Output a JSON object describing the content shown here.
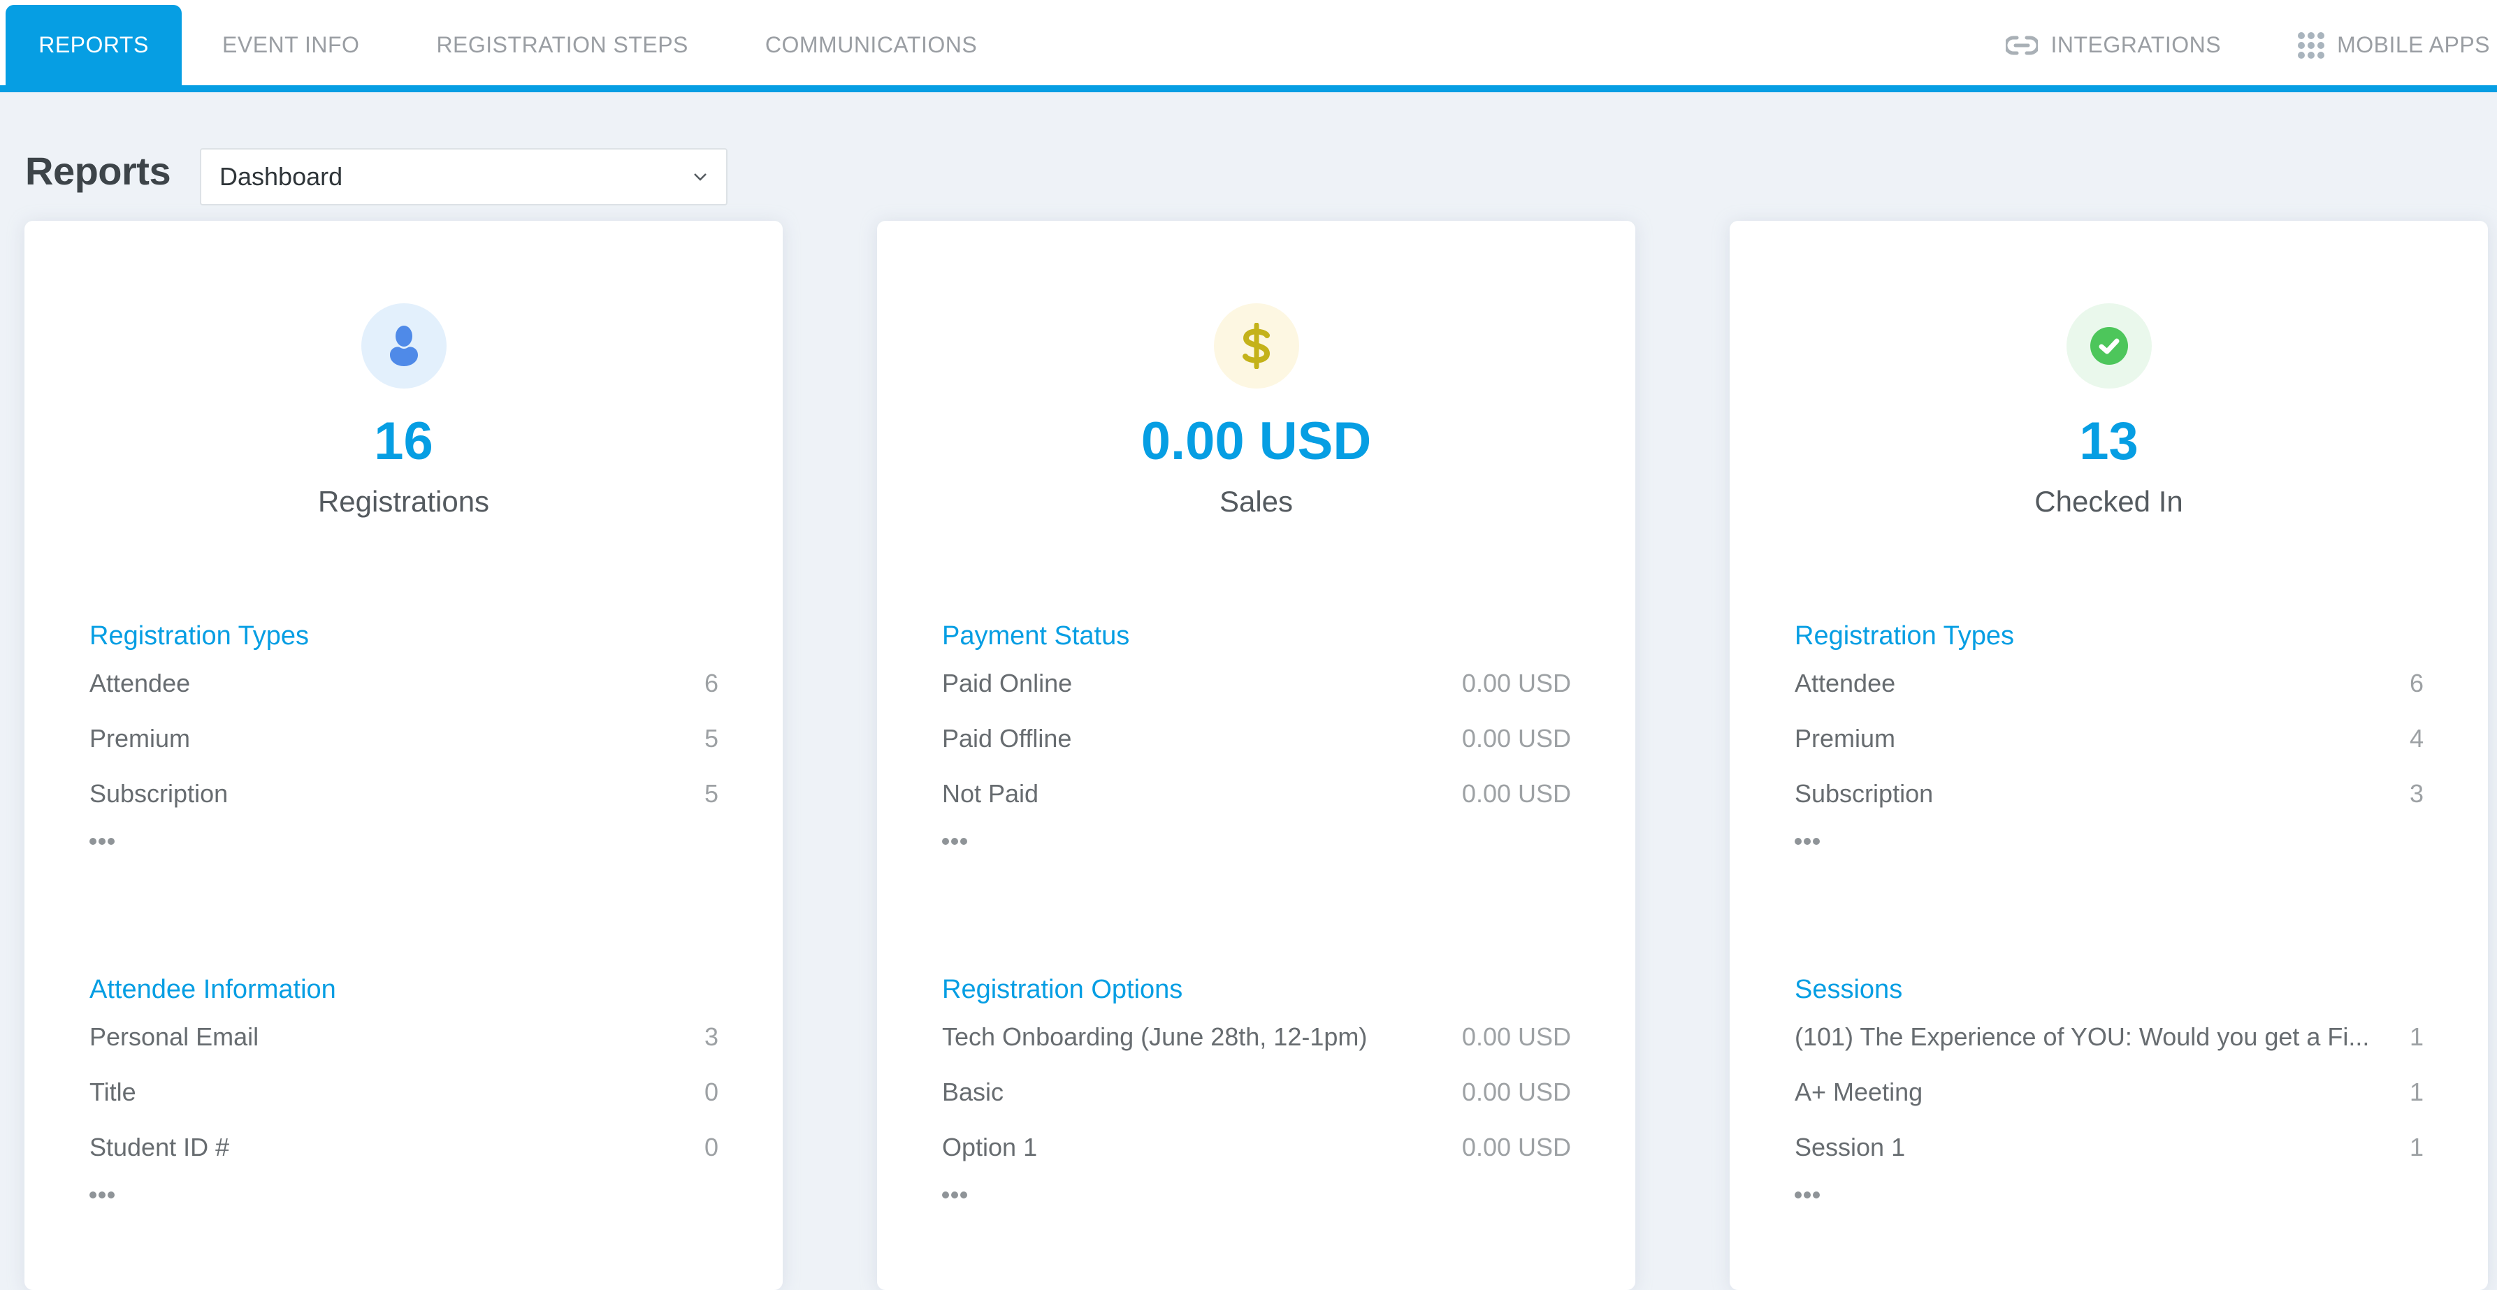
{
  "nav": {
    "tabs": [
      {
        "label": "REPORTS",
        "active": true
      },
      {
        "label": "EVENT INFO",
        "active": false
      },
      {
        "label": "REGISTRATION STEPS",
        "active": false
      },
      {
        "label": "COMMUNICATIONS",
        "active": false
      }
    ],
    "right_links": [
      {
        "label": "INTEGRATIONS",
        "icon": "link-icon"
      },
      {
        "label": "MOBILE APPS",
        "icon": "grid-icon"
      }
    ]
  },
  "header": {
    "title": "Reports",
    "report_select": {
      "value": "Dashboard"
    }
  },
  "colors": {
    "accent": "#069ee3",
    "background": "#eef2f7",
    "user_icon": "#4f8ae8",
    "dollar_icon": "#c4b21a",
    "check_icon": "#4dc65b"
  },
  "cards": [
    {
      "icon": "user-icon",
      "value": "16",
      "label": "Registrations",
      "sections": [
        {
          "title": "Registration Types",
          "rows": [
            {
              "label": "Attendee",
              "value": "6"
            },
            {
              "label": "Premium",
              "value": "5"
            },
            {
              "label": "Subscription",
              "value": "5"
            }
          ]
        },
        {
          "title": "Attendee Information",
          "rows": [
            {
              "label": "Personal Email",
              "value": "3"
            },
            {
              "label": "Title",
              "value": "0"
            },
            {
              "label": "Student ID #",
              "value": "0"
            }
          ]
        }
      ]
    },
    {
      "icon": "dollar-icon",
      "value": "0.00 USD",
      "label": "Sales",
      "sections": [
        {
          "title": "Payment Status",
          "rows": [
            {
              "label": "Paid Online",
              "value": "0.00 USD"
            },
            {
              "label": "Paid Offline",
              "value": "0.00 USD"
            },
            {
              "label": "Not Paid",
              "value": "0.00 USD"
            }
          ]
        },
        {
          "title": "Registration Options",
          "rows": [
            {
              "label": "Tech Onboarding (June 28th, 12-1pm)",
              "value": "0.00 USD"
            },
            {
              "label": "Basic",
              "value": "0.00 USD"
            },
            {
              "label": "Option 1",
              "value": "0.00 USD"
            }
          ]
        }
      ]
    },
    {
      "icon": "check-circle-icon",
      "value": "13",
      "label": "Checked In",
      "sections": [
        {
          "title": "Registration Types",
          "rows": [
            {
              "label": "Attendee",
              "value": "6"
            },
            {
              "label": "Premium",
              "value": "4"
            },
            {
              "label": "Subscription",
              "value": "3"
            }
          ]
        },
        {
          "title": "Sessions",
          "rows": [
            {
              "label": "(101) The Experience of YOU: Would you get a Fi...",
              "value": "1"
            },
            {
              "label": "A+ Meeting",
              "value": "1"
            },
            {
              "label": "Session 1",
              "value": "1"
            }
          ]
        }
      ]
    }
  ]
}
